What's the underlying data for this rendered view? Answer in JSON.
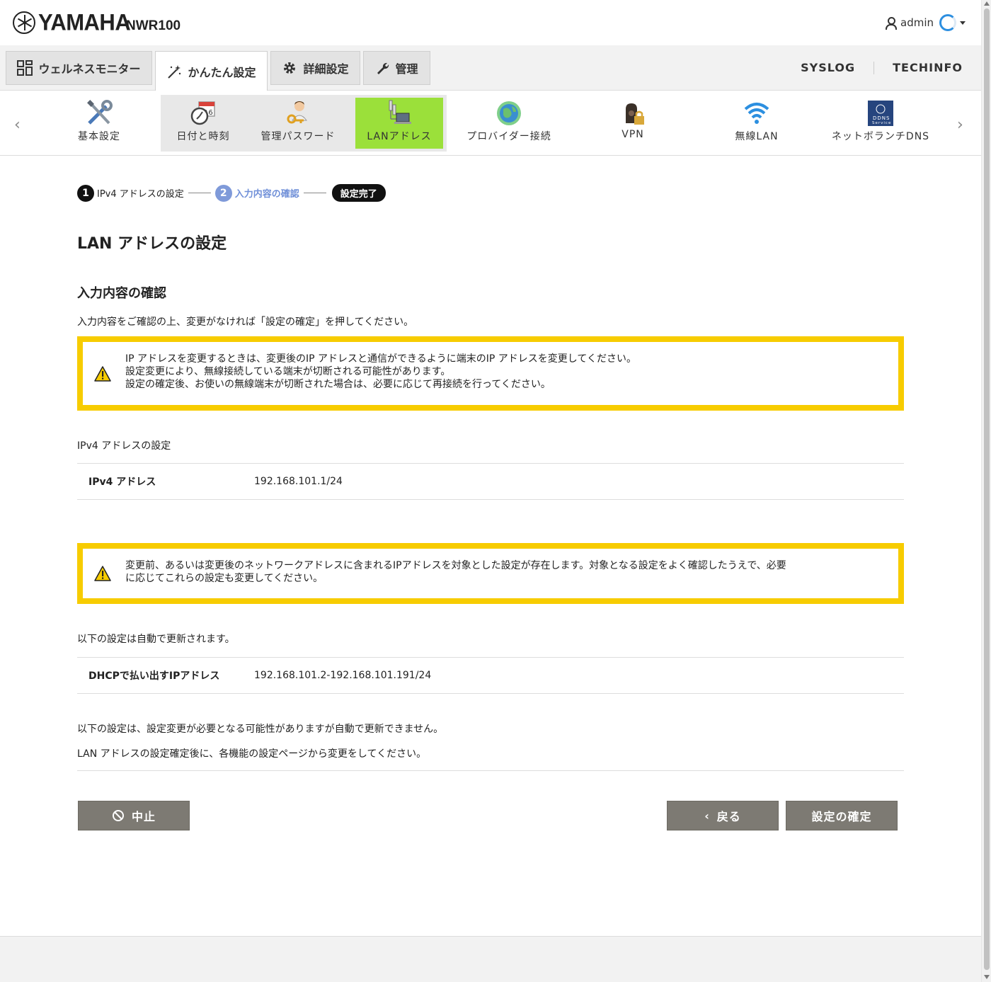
{
  "header": {
    "brand": "YAMAHA",
    "model": "NWR100",
    "user": "admin"
  },
  "main_tabs": [
    {
      "label": "ウェルネスモニター",
      "icon": "grid-icon"
    },
    {
      "label": "かんたん設定",
      "icon": "magic-wand-icon",
      "active": true
    },
    {
      "label": "詳細設定",
      "icon": "gear-icon"
    },
    {
      "label": "管理",
      "icon": "wrench-icon"
    }
  ],
  "links": {
    "syslog": "SYSLOG",
    "techinfo": "TECHINFO"
  },
  "icon_nav": [
    {
      "label": "基本設定",
      "icon": "tools-icon"
    },
    {
      "label": "日付と時刻",
      "icon": "calendar-clock-icon"
    },
    {
      "label": "管理パスワード",
      "icon": "person-key-icon"
    },
    {
      "label": "LANアドレス",
      "icon": "lan-icon",
      "active": true
    },
    {
      "label": "プロバイダー接続",
      "icon": "globe-icon"
    },
    {
      "label": "VPN",
      "icon": "lock-icon"
    },
    {
      "label": "無線LAN",
      "icon": "wifi-icon"
    },
    {
      "label": "ネットボランチDNS",
      "icon": "ddns-icon",
      "badge": "DDNS Service"
    }
  ],
  "stepper": {
    "step1_num": "1",
    "step1_label": "IPv4 アドレスの設定",
    "step2_num": "2",
    "step2_label": "入力内容の確認",
    "step3_label": "設定完了"
  },
  "page_title": "LAN アドレスの設定",
  "section_title": "入力内容の確認",
  "intro": "入力内容をご確認の上、変更がなければ「設定の確定」を押してください。",
  "warning1": {
    "line1": "IP アドレスを変更するときは、変更後のIP アドレスと通信ができるように端末のIP アドレスを変更してください。",
    "line2": "設定変更により、無線接続している端末が切断される可能性があります。",
    "line3": "設定の確定後、お使いの無線端末が切断された場合は、必要に応じて再接続を行ってください。"
  },
  "ipv4_section": {
    "label": "IPv4 アドレスの設定",
    "key": "IPv4 アドレス",
    "value": "192.168.101.1/24"
  },
  "warning2": {
    "line1": "変更前、あるいは変更後のネットワークアドレスに含まれるIPアドレスを対象とした設定が存在します。対象となる設定をよく確認したうえで、必要",
    "line2": "に応じてこれらの設定も変更してください。"
  },
  "auto_section": {
    "label": "以下の設定は自動で更新されます。",
    "key": "DHCPで払い出すIPアドレス",
    "value": "192.168.101.2-192.168.101.191/24"
  },
  "manual_note": {
    "line1": "以下の設定は、設定変更が必要となる可能性がありますが自動で更新できません。",
    "line2": "LAN アドレスの設定確定後に、各機能の設定ページから変更をしてください。"
  },
  "buttons": {
    "cancel": "中止",
    "back": "戻る",
    "confirm": "設定の確定"
  },
  "colors": {
    "warning_border": "#f7cc00",
    "active_nav": "#9be03a",
    "step_current": "#7f9ad9",
    "button": "#7d7a73"
  }
}
